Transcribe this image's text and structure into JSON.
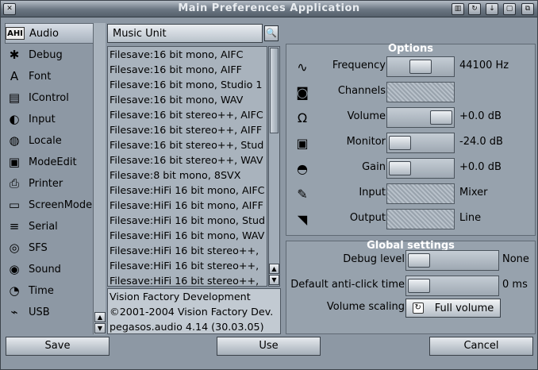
{
  "window": {
    "title": "Main Preferences Application",
    "title_buttons": [
      "gadget-a",
      "gadget-b",
      "gadget-c",
      "gadget-d",
      "gadget-e"
    ]
  },
  "sidebar": {
    "items": [
      {
        "label": "Audio",
        "icon": "ahi-icon",
        "selected": true
      },
      {
        "label": "Debug",
        "icon": "bug-icon"
      },
      {
        "label": "Font",
        "icon": "font-icon"
      },
      {
        "label": "IControl",
        "icon": "icontrol-icon"
      },
      {
        "label": "Input",
        "icon": "mouse-icon"
      },
      {
        "label": "Locale",
        "icon": "globe-icon"
      },
      {
        "label": "ModeEdit",
        "icon": "monitor-icon"
      },
      {
        "label": "Printer",
        "icon": "printer-icon"
      },
      {
        "label": "ScreenMode",
        "icon": "screen-icon"
      },
      {
        "label": "Serial",
        "icon": "serial-icon"
      },
      {
        "label": "SFS",
        "icon": "disk-icon"
      },
      {
        "label": "Sound",
        "icon": "sound-icon"
      },
      {
        "label": "Time",
        "icon": "clock-icon"
      },
      {
        "label": "USB",
        "icon": "usb-icon"
      }
    ]
  },
  "unit": {
    "value": "Music Unit"
  },
  "modes": [
    "Filesave:16 bit mono, AIFC",
    "Filesave:16 bit mono, AIFF",
    "Filesave:16 bit mono, Studio 1",
    "Filesave:16 bit mono, WAV",
    "Filesave:16 bit stereo++, AIFC",
    "Filesave:16 bit stereo++, AIFF",
    "Filesave:16 bit stereo++, Stud",
    "Filesave:16 bit stereo++, WAV",
    "Filesave:8 bit mono, 8SVX",
    "Filesave:HiFi 16 bit mono, AIFC",
    "Filesave:HiFi 16 bit mono, AIFF",
    "Filesave:HiFi 16 bit mono, Stud",
    "Filesave:HiFi 16 bit mono, WAV",
    "Filesave:HiFi 16 bit stereo++,",
    "Filesave:HiFi 16 bit stereo++,",
    "Filesave:HiFi 16 bit stereo++,"
  ],
  "info": {
    "line1": "Vision Factory Development",
    "line2": "©2001-2004 Vision Factory Dev.",
    "line3": "pegasos.audio 4.14 (30.03.05)"
  },
  "options": {
    "title": "Options",
    "rows": [
      {
        "label": "Frequency",
        "value": "44100 Hz",
        "icon": "frequency-icon",
        "level": 0.5,
        "disabled": false
      },
      {
        "label": "Channels",
        "value": "",
        "icon": "speaker-icon",
        "level": 0,
        "disabled": true
      },
      {
        "label": "Volume",
        "value": "+0.0 dB",
        "icon": "headphones-icon",
        "level": 1,
        "disabled": false
      },
      {
        "label": "Monitor",
        "value": "-24.0 dB",
        "icon": "monitor-icon",
        "level": 0,
        "disabled": false
      },
      {
        "label": "Gain",
        "value": "+0.0 dB",
        "icon": "gain-icon",
        "level": 0,
        "disabled": false
      },
      {
        "label": "Input",
        "value": "Mixer",
        "icon": "microphone-icon",
        "level": 0,
        "disabled": true
      },
      {
        "label": "Output",
        "value": "Line",
        "icon": "output-icon",
        "level": 0,
        "disabled": true
      }
    ]
  },
  "global": {
    "title": "Global settings",
    "debug": {
      "label": "Debug level",
      "value": "None",
      "level": 0
    },
    "anticlick": {
      "label": "Default anti-click time",
      "value": "0 ms",
      "level": 0
    },
    "scaling": {
      "label": "Volume scaling",
      "value": "Full volume"
    }
  },
  "buttons": {
    "save": "Save",
    "use": "Use",
    "cancel": "Cancel"
  }
}
